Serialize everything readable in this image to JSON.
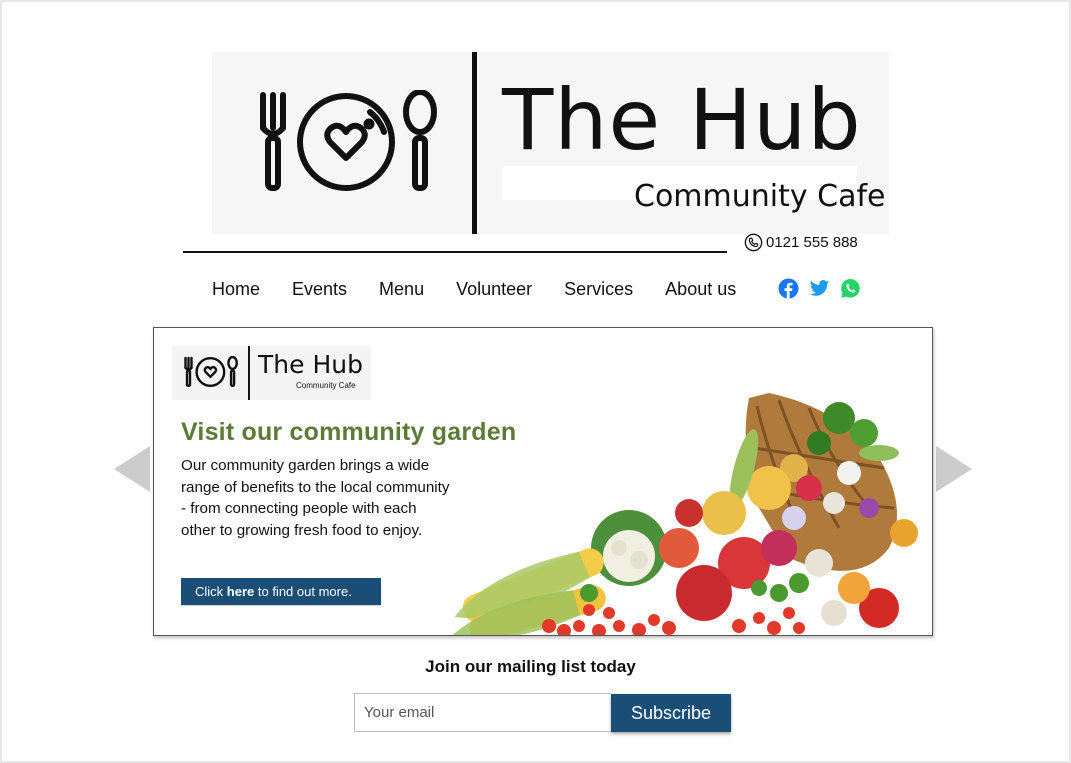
{
  "brand": {
    "title": "The Hub",
    "subtitle": "Community Cafe",
    "logo_icons": [
      "fork-icon",
      "heart-plate-icon",
      "spoon-icon"
    ]
  },
  "contact": {
    "phone_icon": "phone-icon",
    "phone": "0121 555 888"
  },
  "nav": {
    "items": [
      {
        "label": "Home"
      },
      {
        "label": "Events"
      },
      {
        "label": "Menu"
      },
      {
        "label": "Volunteer"
      },
      {
        "label": "Services"
      },
      {
        "label": "About us"
      }
    ],
    "social": [
      {
        "name": "facebook-icon",
        "color": "#1877f2"
      },
      {
        "name": "twitter-icon",
        "color": "#1d9bf0"
      },
      {
        "name": "whatsapp-icon",
        "color": "#25d366"
      }
    ]
  },
  "carousel": {
    "prev_icon": "arrow-left-icon",
    "next_icon": "arrow-right-icon",
    "arrow_color": "#cccccc",
    "slide": {
      "logo_title": "The Hub",
      "logo_subtitle": "Community Cafe",
      "heading": "Visit our community garden",
      "heading_color": "#5b7b36",
      "body": "Our community garden brings a wide range of benefits to the local community - from connecting people with each other to growing fresh food to enjoy.",
      "button_prefix": "Click ",
      "button_bold": "here",
      "button_suffix": " to find out more.",
      "button_color": "#1b4e77",
      "image": "vegetable-basket-image"
    }
  },
  "mailing": {
    "heading": "Join our mailing list today",
    "email_placeholder": "Your email",
    "subscribe_label": "Subscribe",
    "accent": "#1b4e77"
  }
}
